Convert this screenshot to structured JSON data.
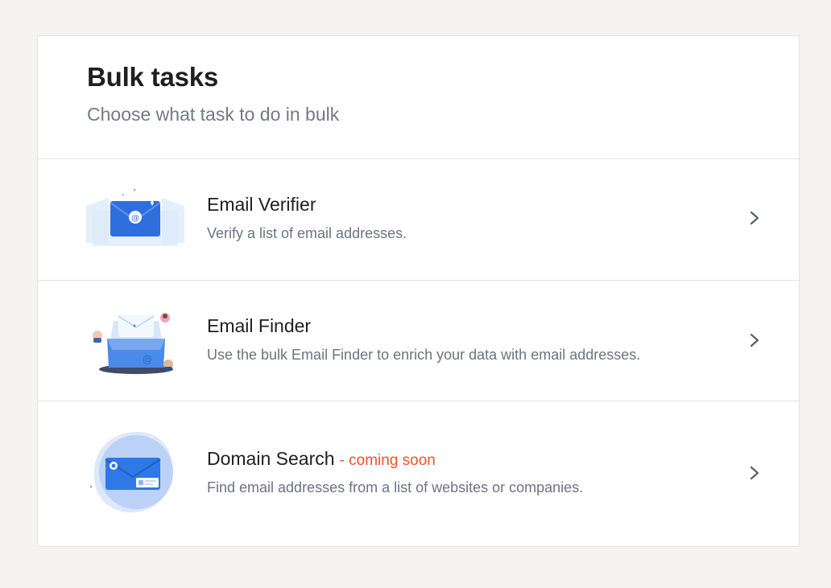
{
  "header": {
    "title": "Bulk tasks",
    "subtitle": "Choose what task to do in bulk"
  },
  "tasks": [
    {
      "title": "Email Verifier",
      "description": "Verify a list of email addresses.",
      "icon": "email-verifier-illustration"
    },
    {
      "title": "Email Finder",
      "description": "Use the bulk Email Finder to enrich your data with email addresses.",
      "icon": "email-finder-illustration"
    },
    {
      "title": "Domain Search",
      "badge": "- coming soon",
      "description": "Find email addresses from a list of websites or companies.",
      "icon": "domain-search-illustration"
    }
  ],
  "colors": {
    "background": "#f5f4f2",
    "card": "#ffffff",
    "border": "#e3e3e3",
    "accent_blue": "#2f6fdd",
    "coming_soon": "#f0532d",
    "title_text": "#1f1f1f",
    "muted_text": "#717a85"
  }
}
